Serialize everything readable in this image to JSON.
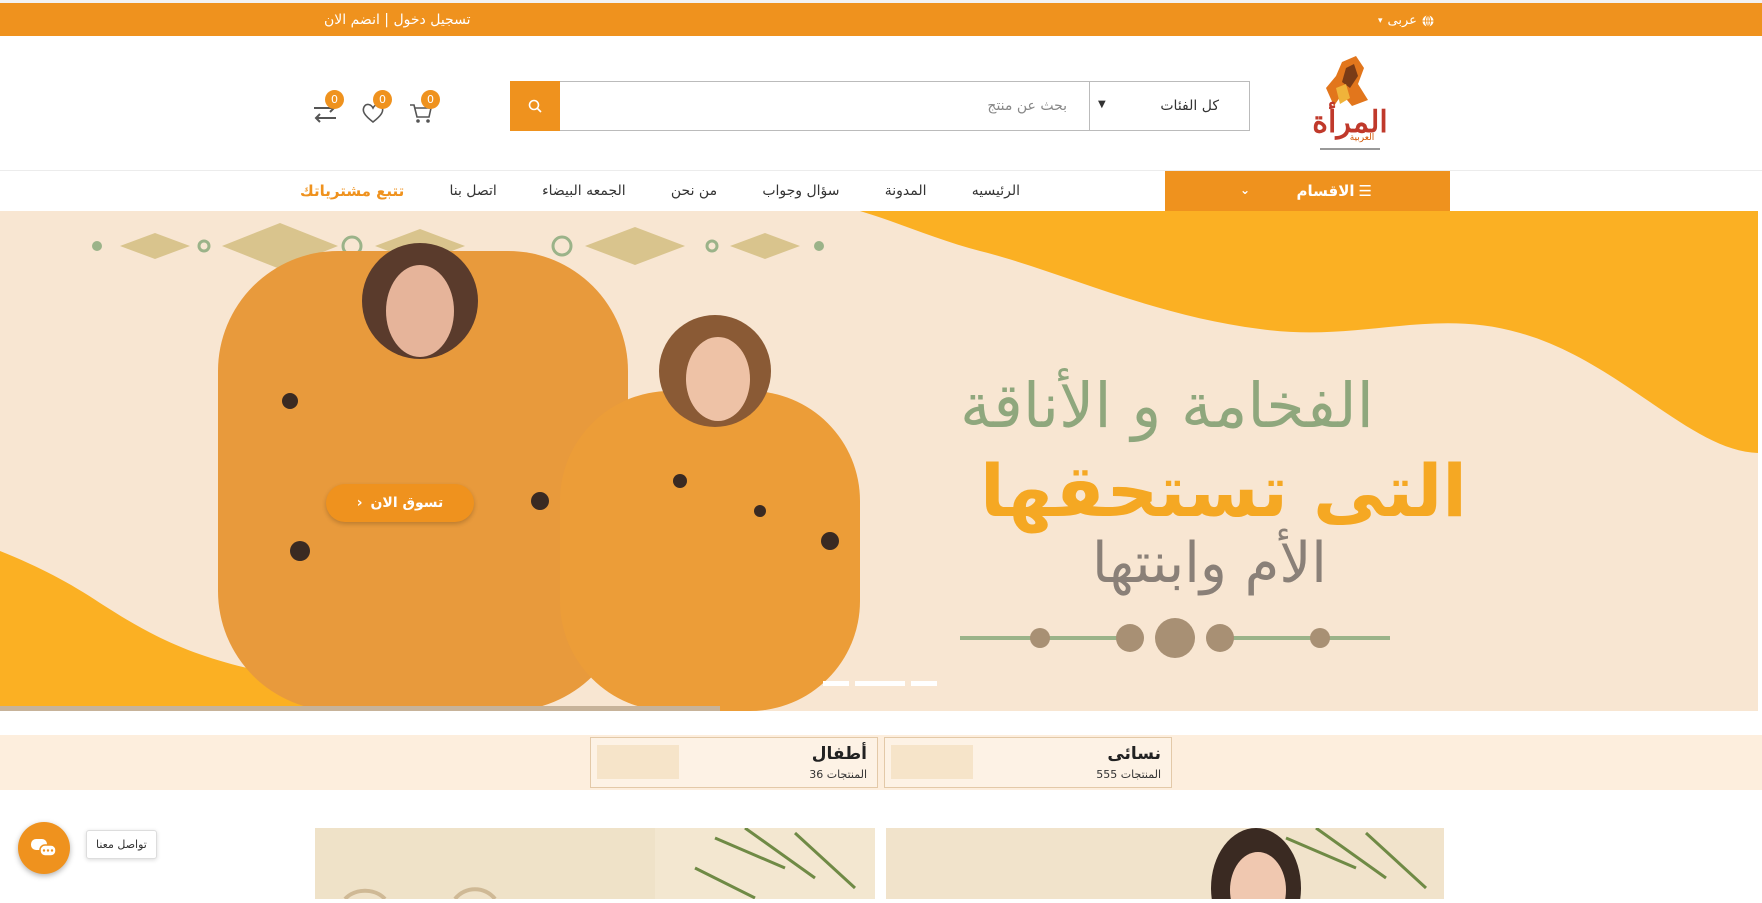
{
  "topbar": {
    "login_text": "تسجيل دخول | انضم الان",
    "language": "عربى"
  },
  "header": {
    "logo_text": "المرأة العربية",
    "search": {
      "placeholder": "بحث عن منتج",
      "category": "كل الفئات"
    },
    "cart_count": "0",
    "wishlist_count": "0",
    "compare_count": "0"
  },
  "nav": {
    "categories_label": "الاقسام",
    "items": [
      "الرئيسيه",
      "المدونة",
      "سؤال وجواب",
      "من نحن",
      "الجمعه البيضاء",
      "اتصل بنا",
      "تتبع مشترياتك"
    ]
  },
  "hero": {
    "line1": "الفخامة و الأناقة",
    "line2": "التى تستحقها",
    "line3": "الأم وابنتها",
    "button": "تسوق الان"
  },
  "categories": [
    {
      "name": "نسائى",
      "count": "555 المنتجات"
    },
    {
      "name": "أطفال",
      "count": "36 المنتجات"
    }
  ],
  "chat": {
    "label": "تواصل معنا"
  },
  "colors": {
    "accent": "#ef921e",
    "hero_bg": "#f8e6d2",
    "hero_yellow": "#fbb023"
  }
}
